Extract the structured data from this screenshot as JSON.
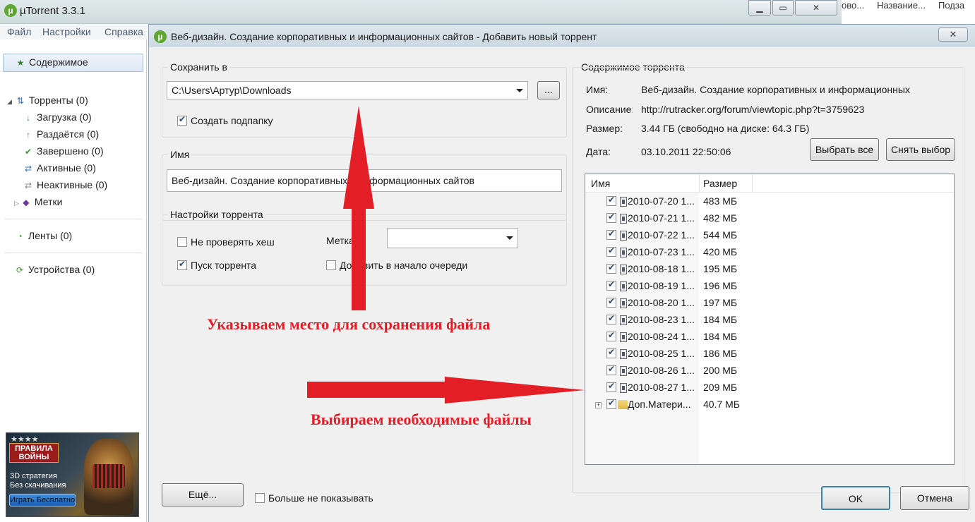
{
  "main_window": {
    "title": "µTorrent 3.3.1",
    "logo": "µ",
    "buttons": [
      "minimize-icon",
      "maximize-icon",
      "close-icon"
    ],
    "bg_right_texts": [
      "ово...",
      "Название...",
      "Подза"
    ]
  },
  "menu": {
    "items": [
      "Файл",
      "Настройки",
      "Справка"
    ]
  },
  "sidebar": {
    "selected": {
      "icon": "star-icon",
      "label": "Содержимое"
    },
    "torrents": {
      "label": "Торренты (0)"
    },
    "items": [
      {
        "icon": "download-icon",
        "label": "Загрузка (0)"
      },
      {
        "icon": "upload-icon",
        "label": "Раздаётся (0)"
      },
      {
        "icon": "checkmark-icon",
        "label": "Завершено (0)"
      },
      {
        "icon": "active-icon",
        "label": "Активные (0)"
      },
      {
        "icon": "inactive-icon",
        "label": "Неактивные (0)"
      }
    ],
    "labels": {
      "label": "Метки"
    },
    "feeds": {
      "label": "Ленты (0)"
    },
    "devices": {
      "label": "Устройства (0)"
    }
  },
  "ad": {
    "stars": "★★★★",
    "title": "ПРАВИЛА ВОЙНЫ",
    "line1": "3D стратегия",
    "line2": "Без скачивания",
    "button": "Играть Бесплатно!"
  },
  "dialog": {
    "title": "Веб-дизайн. Создание корпоративных и информационных сайтов - Добавить новый торрент",
    "save_in": {
      "group_label": "Сохранить в",
      "path": "C:\\Users\\Артур\\Downloads",
      "browse_label": "...",
      "create_subfolder_label": "Создать подпапку",
      "create_subfolder_checked": true
    },
    "name": {
      "group_label": "Имя",
      "value": "Веб-дизайн. Создание корпоративных и информационных сайтов"
    },
    "settings": {
      "group_label": "Настройки торрента",
      "skip_hash_label": "Не проверять хеш",
      "skip_hash_checked": false,
      "start_label": "Пуск торрента",
      "start_checked": true,
      "tag_label": "Метка",
      "tag_value": "",
      "add_queue_top_label": "Добавить в начало очереди",
      "add_queue_top_checked": false
    },
    "contents": {
      "group_label": "Содержимое торрента",
      "name_key": "Имя:",
      "name_val": "Веб-дизайн. Создание корпоративных и информационных",
      "desc_key": "Описание:",
      "desc_val": "http://rutracker.org/forum/viewtopic.php?t=3759623",
      "size_key": "Размер:",
      "size_val": "3.44 ГБ (свободно на диске: 64.3 ГБ)",
      "date_key": "Дата:",
      "date_val": "03.10.2011 22:50:06",
      "select_all_label": "Выбрать все",
      "deselect_label": "Снять выбор",
      "col_name": "Имя",
      "col_size": "Размер",
      "files": [
        {
          "name": "2010-07-20 1...",
          "size": "483 МБ",
          "checked": true
        },
        {
          "name": "2010-07-21 1...",
          "size": "482 МБ",
          "checked": true
        },
        {
          "name": "2010-07-22 1...",
          "size": "544 МБ",
          "checked": true
        },
        {
          "name": "2010-07-23 1...",
          "size": "420 МБ",
          "checked": true
        },
        {
          "name": "2010-08-18 1...",
          "size": "195 МБ",
          "checked": true
        },
        {
          "name": "2010-08-19 1...",
          "size": "196 МБ",
          "checked": true
        },
        {
          "name": "2010-08-20 1...",
          "size": "197 МБ",
          "checked": true
        },
        {
          "name": "2010-08-23 1...",
          "size": "184 МБ",
          "checked": true
        },
        {
          "name": "2010-08-24 1...",
          "size": "184 МБ",
          "checked": true
        },
        {
          "name": "2010-08-25 1...",
          "size": "186 МБ",
          "checked": true
        },
        {
          "name": "2010-08-26 1...",
          "size": "200 МБ",
          "checked": true
        },
        {
          "name": "2010-08-27 1...",
          "size": "209 МБ",
          "checked": true
        }
      ],
      "folder": {
        "name": "Доп.Матери...",
        "size": "40.7 МБ",
        "checked": true
      }
    },
    "footer": {
      "more_label": "Ещё...",
      "dont_show_label": "Больше не показывать",
      "dont_show_checked": false,
      "ok_label": "OK",
      "cancel_label": "Отмена"
    }
  },
  "annotations": {
    "save_location": "Указываем место для сохранения файла",
    "select_files": "Выбираем необходимые файлы",
    "arrow_color": "#e41e26"
  }
}
